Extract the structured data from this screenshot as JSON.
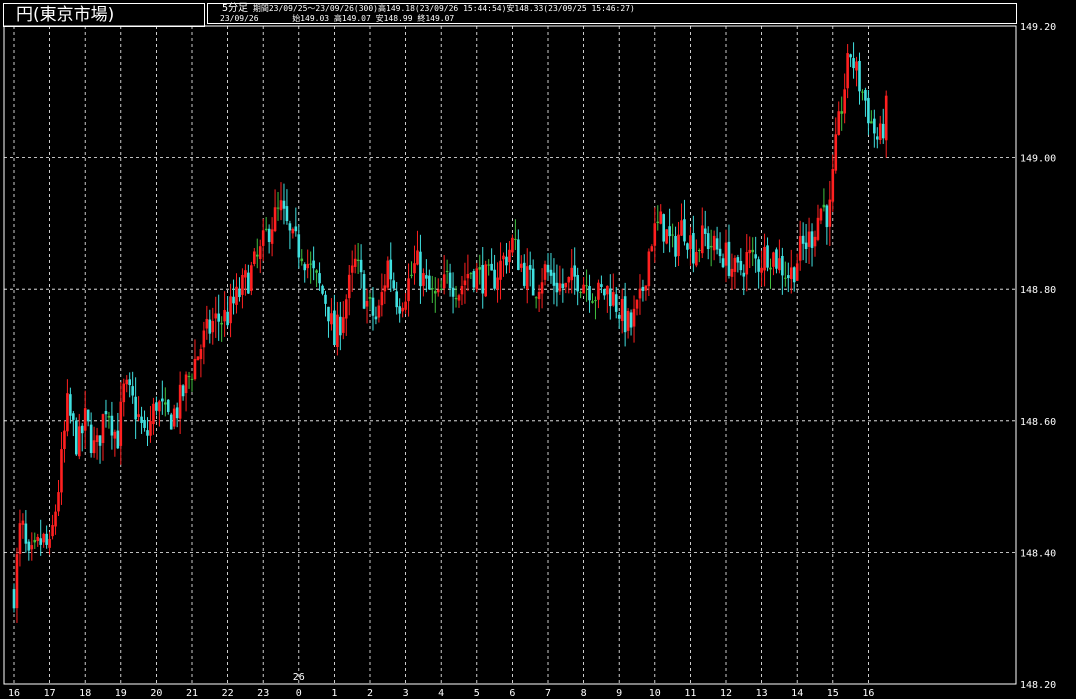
{
  "header": {
    "title": "円(東京市場)",
    "timeframe": "5分足",
    "range_info": "期間23/09/25～23/09/26(300)高149.18(23/09/26 15:44:54)安148.33(23/09/25 15:46:27)",
    "date": "23/09/26",
    "ohlc": "始149.03 高149.07 安148.99 終149.07"
  },
  "chart_data": {
    "type": "candlestick",
    "title": "",
    "y_ticks": [
      "149.20",
      "149.00",
      "148.80",
      "148.60",
      "148.40",
      "148.20"
    ],
    "ylim": [
      148.2,
      149.2
    ],
    "x_ticks": [
      "16",
      "17",
      "18",
      "19",
      "20",
      "21",
      "22",
      "23",
      "0",
      "1",
      "2",
      "3",
      "4",
      "5",
      "6",
      "7",
      "8",
      "9",
      "10",
      "11",
      "12",
      "13",
      "14",
      "15",
      "16"
    ],
    "day_marker": "26",
    "grid": true,
    "colors": {
      "up": "#ff2020",
      "down": "#40e0e0",
      "flat": "#40c040",
      "grid": "#ffffff",
      "background": "#000000"
    },
    "x_tick_hours": [
      0,
      1,
      2,
      3,
      4,
      5,
      6,
      7,
      8,
      9,
      10,
      11,
      12,
      13,
      14,
      15,
      16,
      17,
      18,
      19,
      20,
      21,
      22,
      23,
      24
    ],
    "close_path": [
      [
        0,
        148.34
      ],
      [
        0.2,
        148.45
      ],
      [
        0.4,
        148.38
      ],
      [
        0.8,
        148.42
      ],
      [
        1.0,
        148.4
      ],
      [
        1.3,
        148.52
      ],
      [
        1.5,
        148.62
      ],
      [
        1.8,
        148.56
      ],
      [
        2.0,
        148.6
      ],
      [
        2.3,
        148.55
      ],
      [
        2.6,
        148.63
      ],
      [
        2.9,
        148.57
      ],
      [
        3.1,
        148.65
      ],
      [
        3.4,
        148.62
      ],
      [
        3.7,
        148.57
      ],
      [
        4.0,
        148.63
      ],
      [
        4.3,
        148.6
      ],
      [
        4.6,
        148.62
      ],
      [
        5.0,
        148.68
      ],
      [
        5.3,
        148.72
      ],
      [
        5.6,
        148.75
      ],
      [
        6.0,
        148.76
      ],
      [
        6.3,
        148.79
      ],
      [
        6.6,
        148.82
      ],
      [
        6.9,
        148.85
      ],
      [
        7.2,
        148.9
      ],
      [
        7.5,
        148.92
      ],
      [
        7.8,
        148.87
      ],
      [
        8.1,
        148.86
      ],
      [
        8.4,
        148.82
      ],
      [
        8.8,
        148.78
      ],
      [
        9.0,
        148.72
      ],
      [
        9.3,
        148.78
      ],
      [
        9.6,
        148.84
      ],
      [
        9.9,
        148.78
      ],
      [
        10.2,
        148.75
      ],
      [
        10.5,
        148.84
      ],
      [
        10.8,
        148.78
      ],
      [
        11.0,
        148.8
      ],
      [
        11.3,
        148.84
      ],
      [
        11.6,
        148.8
      ],
      [
        11.9,
        148.78
      ],
      [
        12.2,
        148.82
      ],
      [
        12.5,
        148.8
      ],
      [
        12.8,
        148.83
      ],
      [
        13.1,
        148.82
      ],
      [
        13.4,
        148.81
      ],
      [
        13.7,
        148.84
      ],
      [
        14.0,
        148.87
      ],
      [
        14.3,
        148.83
      ],
      [
        14.6,
        148.8
      ],
      [
        14.9,
        148.83
      ],
      [
        15.2,
        148.81
      ],
      [
        15.5,
        148.8
      ],
      [
        15.8,
        148.82
      ],
      [
        16.1,
        148.81
      ],
      [
        16.4,
        148.79
      ],
      [
        16.7,
        148.8
      ],
      [
        17.0,
        148.77
      ],
      [
        17.3,
        148.74
      ],
      [
        17.6,
        148.78
      ],
      [
        17.9,
        148.88
      ],
      [
        18.2,
        148.9
      ],
      [
        18.5,
        148.86
      ],
      [
        18.8,
        148.9
      ],
      [
        19.1,
        148.86
      ],
      [
        19.4,
        148.88
      ],
      [
        19.7,
        148.86
      ],
      [
        20.0,
        148.85
      ],
      [
        20.3,
        148.82
      ],
      [
        20.6,
        148.85
      ],
      [
        20.9,
        148.84
      ],
      [
        21.2,
        148.86
      ],
      [
        21.5,
        148.84
      ],
      [
        21.8,
        148.82
      ],
      [
        22.1,
        148.86
      ],
      [
        22.4,
        148.88
      ],
      [
        22.7,
        148.93
      ],
      [
        22.9,
        148.91
      ],
      [
        23.1,
        149.02
      ],
      [
        23.3,
        149.1
      ],
      [
        23.5,
        149.16
      ],
      [
        23.7,
        149.12
      ],
      [
        23.9,
        149.09
      ],
      [
        24.1,
        149.05
      ],
      [
        24.3,
        149.02
      ],
      [
        24.5,
        149.07
      ]
    ]
  }
}
